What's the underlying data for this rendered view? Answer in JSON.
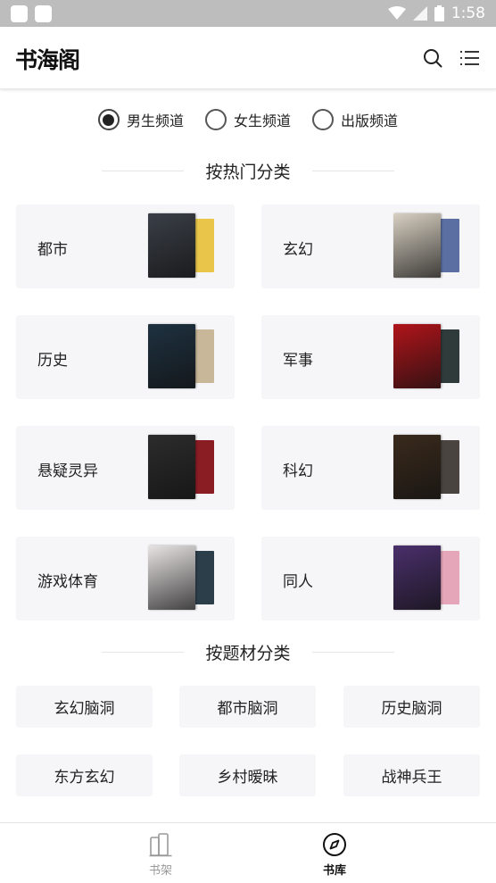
{
  "status_bar": {
    "time": "1:58"
  },
  "header": {
    "logo": "书海阁"
  },
  "channels": [
    {
      "label": "男生频道",
      "selected": true
    },
    {
      "label": "女生频道",
      "selected": false
    },
    {
      "label": "出版频道",
      "selected": false
    }
  ],
  "hot": {
    "title": "按热门分类",
    "categories": [
      {
        "name": "都市",
        "front_color": "#3a3f47",
        "back_color": "#e9c64a"
      },
      {
        "name": "玄幻",
        "front_color": "#d8d0c2",
        "back_color": "#5b6fa3"
      },
      {
        "name": "历史",
        "front_color": "#1e3140",
        "back_color": "#c9b79a"
      },
      {
        "name": "军事",
        "front_color": "#b0141a",
        "back_color": "#2f3a3a"
      },
      {
        "name": "悬疑灵异",
        "front_color": "#2c2c2c",
        "back_color": "#8a1c24"
      },
      {
        "name": "科幻",
        "front_color": "#3a2a1c",
        "back_color": "#4a4440"
      },
      {
        "name": "游戏体育",
        "front_color": "#e8e4e4",
        "back_color": "#2c3e4a"
      },
      {
        "name": "同人",
        "front_color": "#4a2f6b",
        "back_color": "#e4a6b8"
      }
    ]
  },
  "topics": {
    "title": "按题材分类",
    "items": [
      "玄幻脑洞",
      "都市脑洞",
      "历史脑洞",
      "东方玄幻",
      "乡村暧昧",
      "战神兵王"
    ]
  },
  "bottom_nav": {
    "shelf": "书架",
    "library": "书库"
  }
}
